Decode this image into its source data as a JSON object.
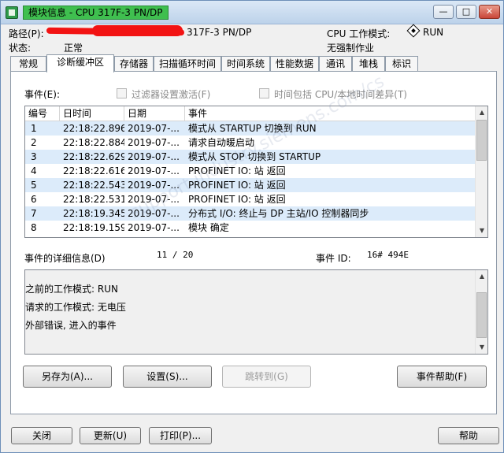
{
  "window": {
    "title": "模块信息 - CPU 317F-3 PN/DP",
    "min_label": "—",
    "max_label": "□",
    "close_label": "✕"
  },
  "info": {
    "path_label": "路径(P):",
    "path_value": "317F-3 PN/DP",
    "status_label": "状态:",
    "status_value": "正常",
    "cpu_mode_label": "CPU 工作模式:",
    "cpu_mode_value": "RUN",
    "force_text": "无强制作业"
  },
  "tabs": [
    "常规",
    "诊断缓冲区",
    "存储器",
    "扫描循环时间",
    "时间系统",
    "性能数据",
    "通讯",
    "堆栈",
    "标识"
  ],
  "active_tab": "诊断缓冲区",
  "events_section": {
    "label": "事件(E):",
    "filter_label": "过滤器设置激活(F)",
    "time_label": "时间包括 CPU/本地时间差异(T)"
  },
  "table": {
    "columns": [
      "编号",
      "日时间",
      "日期",
      "事件"
    ],
    "rows": [
      [
        "1",
        "22:18:22.896",
        "2019-07-...",
        "模式从 STARTUP 切换到 RUN"
      ],
      [
        "2",
        "22:18:22.884",
        "2019-07-...",
        "请求自动暖启动"
      ],
      [
        "3",
        "22:18:22.629",
        "2019-07-...",
        "模式从 STOP 切换到 STARTUP"
      ],
      [
        "4",
        "22:18:22.616",
        "2019-07-...",
        "PROFINET IO: 站 返回"
      ],
      [
        "5",
        "22:18:22.543",
        "2019-07-...",
        "PROFINET IO: 站 返回"
      ],
      [
        "6",
        "22:18:22.531",
        "2019-07-...",
        "PROFINET IO: 站 返回"
      ],
      [
        "7",
        "22:18:19.345",
        "2019-07-...",
        "分布式 I/O: 终止与 DP 主站/IO 控制器同步"
      ],
      [
        "8",
        "22:18:19.159",
        "2019-07-...",
        "模块 确定"
      ]
    ]
  },
  "details": {
    "label": "事件的详细信息(D)",
    "counter": "11 / 20",
    "event_id_label": "事件 ID:",
    "event_id_value": "16# 494E",
    "lines": [
      "之前的工作模式: RUN",
      "请求的工作模式: 无电压",
      "外部错误, 进入的事件"
    ]
  },
  "buttons": {
    "save_as": "另存为(A)...",
    "settings": "设置(S)...",
    "goto": "跳转到(G)",
    "event_help": "事件帮助(F)",
    "close": "关闭",
    "refresh": "更新(U)",
    "print": "打印(P)...",
    "help": "帮助"
  },
  "watermark": "support.industry.siemens.com/cs",
  "colors": {
    "title_highlight": "#3fbf4f",
    "row_alt": "#dcebfa",
    "redaction": "#f21313"
  }
}
